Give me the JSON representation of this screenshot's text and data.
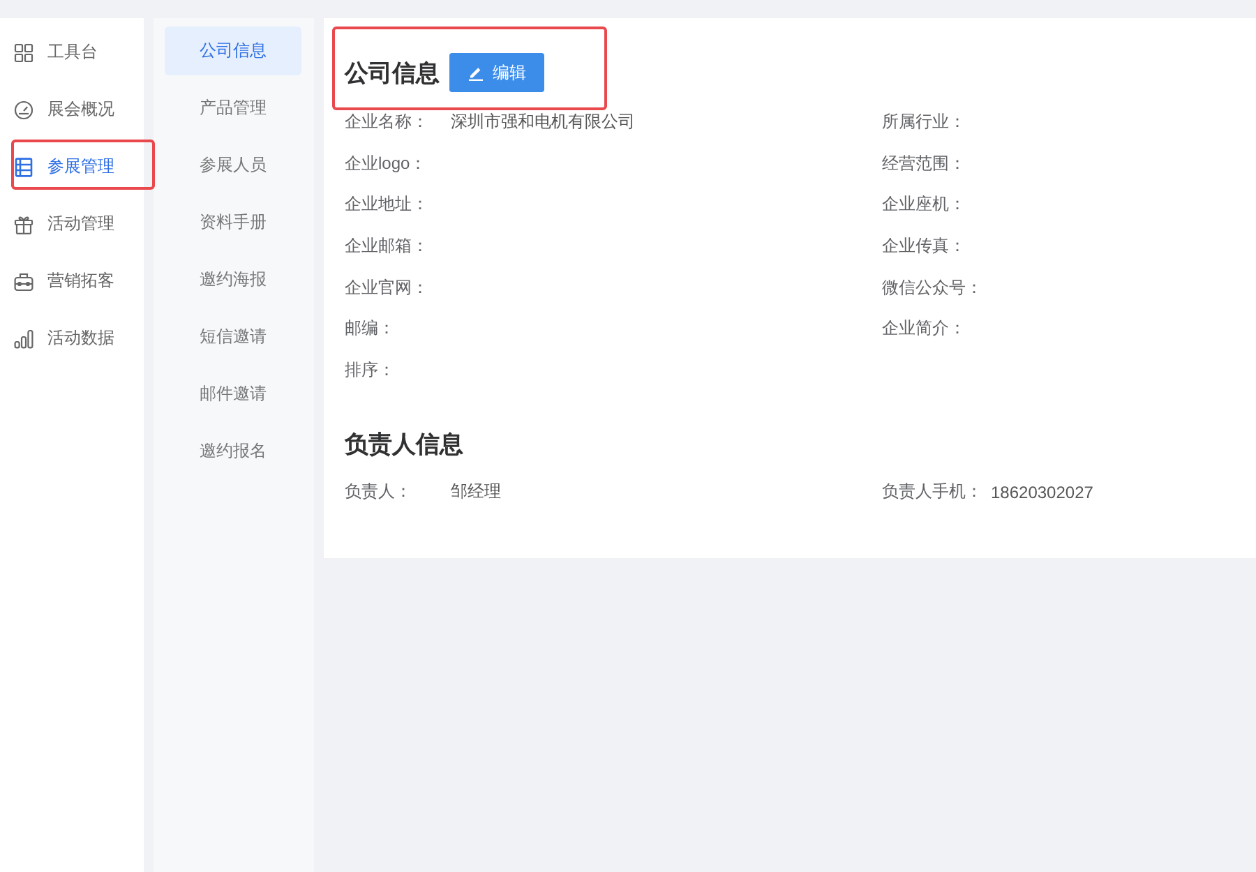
{
  "main_menu": [
    {
      "label": "工具台",
      "selected": false,
      "highlighted": false
    },
    {
      "label": "展会概况",
      "selected": false,
      "highlighted": false
    },
    {
      "label": "参展管理",
      "selected": true,
      "highlighted": true
    },
    {
      "label": "活动管理",
      "selected": false,
      "highlighted": false
    },
    {
      "label": "营销拓客",
      "selected": false,
      "highlighted": false
    },
    {
      "label": "活动数据",
      "selected": false,
      "highlighted": false
    }
  ],
  "sub_menu": [
    {
      "label": "公司信息",
      "selected": true
    },
    {
      "label": "产品管理",
      "selected": false
    },
    {
      "label": "参展人员",
      "selected": false
    },
    {
      "label": "资料手册",
      "selected": false
    },
    {
      "label": "邀约海报",
      "selected": false
    },
    {
      "label": "短信邀请",
      "selected": false
    },
    {
      "label": "邮件邀请",
      "selected": false
    },
    {
      "label": "邀约报名",
      "selected": false
    }
  ],
  "sections": [
    {
      "title": "公司信息",
      "highlighted": true,
      "edit_button": {
        "label": "编辑"
      },
      "fields": [
        {
          "label": "企业名称：",
          "value": "深圳市强和电机有限公司"
        },
        {
          "label": "所属行业："
        },
        {
          "label": "企业logo："
        },
        {
          "label": "经营范围："
        },
        {
          "label": "企业地址："
        },
        {
          "label": "企业座机："
        },
        {
          "label": "企业邮箱："
        },
        {
          "label": "企业传真："
        },
        {
          "label": "企业官网："
        },
        {
          "label": "微信公众号："
        },
        {
          "label": "邮编："
        },
        {
          "label": "企业简介："
        },
        {
          "label": "排序："
        }
      ]
    },
    {
      "title": "负责人信息",
      "highlighted": false,
      "fields": [
        {
          "label": "负责人：",
          "value": "邹经理"
        },
        {
          "label": "负责人手机：",
          "value": "18620302027"
        }
      ]
    }
  ]
}
